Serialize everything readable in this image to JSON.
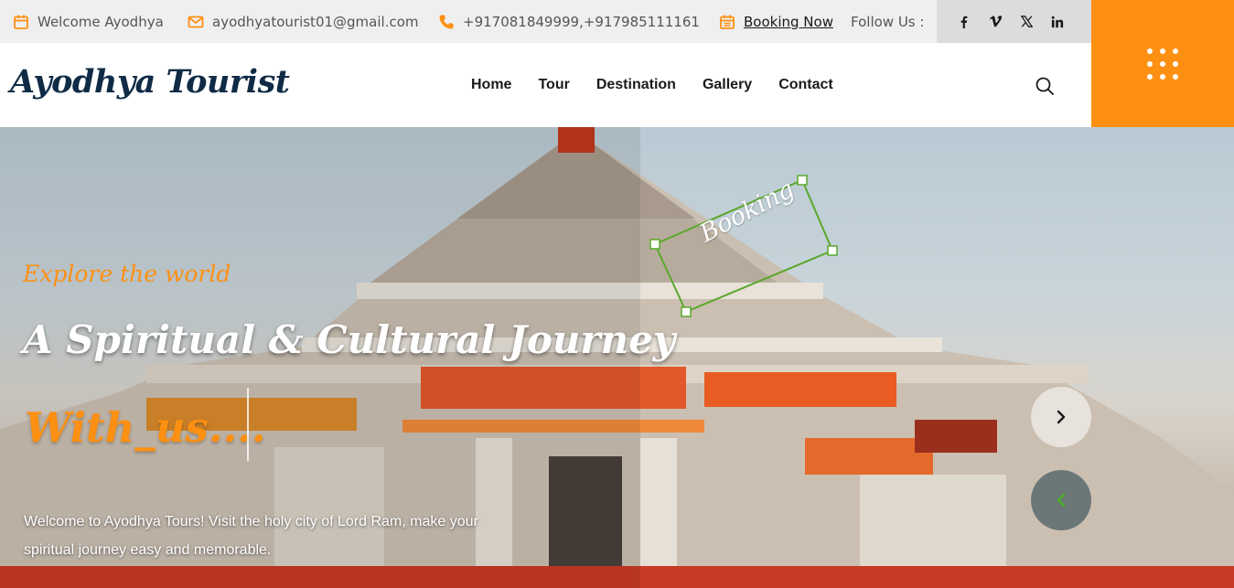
{
  "topbar": {
    "welcome": "Welcome Ayodhya",
    "email": "ayodhyatourist01@gmail.com",
    "phone": "+917081849999,+917985111161",
    "booking": "Booking Now",
    "follow": "Follow Us :",
    "social": [
      "facebook-icon",
      "vimeo-icon",
      "x-icon",
      "linkedin-icon"
    ]
  },
  "header": {
    "logo": "Ayodhya Tourist",
    "nav": [
      "Home",
      "Tour",
      "Destination",
      "Gallery",
      "Contact"
    ]
  },
  "hero": {
    "kicker": "Explore the world",
    "title": "A Spiritual & Cultural Journey",
    "subtitle": "With_us....",
    "description": "Welcome to Ayodhya Tours! Visit the holy city of Lord Ram, make your spiritual journey easy and memorable.",
    "stamp": "Booking"
  },
  "colors": {
    "accent": "#fd9012",
    "navy": "#0f2b46",
    "topbar_bg": "#efefef"
  }
}
